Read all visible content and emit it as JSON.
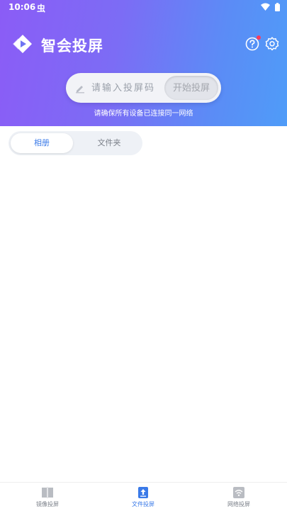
{
  "status_bar": {
    "time": "10:06",
    "bug_glyph": "虫"
  },
  "header": {
    "app_title": "智会投屏",
    "code_placeholder": "请输入投屏码",
    "start_button": "开始投屏",
    "hint": "请确保所有设备已连接同一网络"
  },
  "tabs": [
    {
      "label": "相册",
      "active": true
    },
    {
      "label": "文件夹",
      "active": false
    }
  ],
  "bottom_nav": [
    {
      "label": "镜像投屏",
      "icon": "book-icon",
      "active": false
    },
    {
      "label": "文件投屏",
      "icon": "file-upload-icon",
      "active": true
    },
    {
      "label": "网络投屏",
      "icon": "wifi-icon",
      "active": false
    }
  ],
  "colors": {
    "gradient_start": "#8b5cf6",
    "gradient_end": "#4f9cf8",
    "accent": "#3a7ae8",
    "badge": "#ff3b5c"
  }
}
